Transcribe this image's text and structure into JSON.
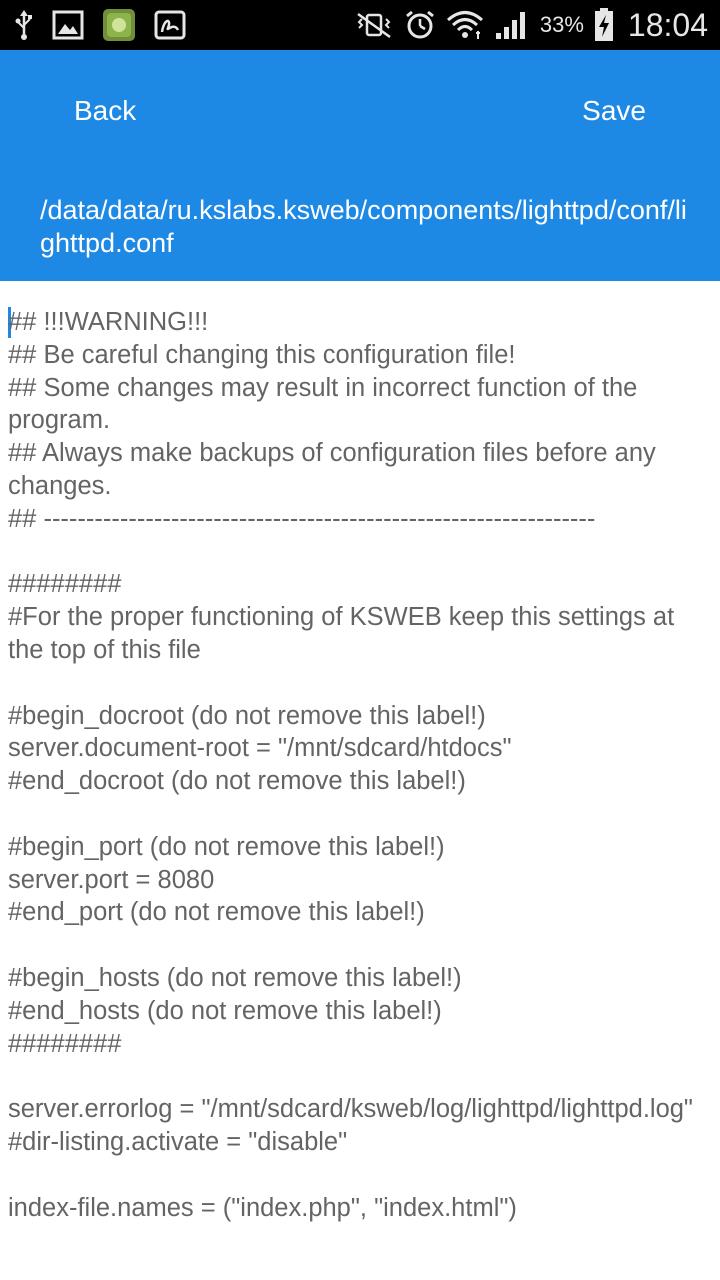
{
  "status_bar": {
    "icons_left": [
      "usb-icon",
      "image-notification-icon",
      "app-notification-icon",
      "signature-notification-icon"
    ],
    "icons_right": [
      "mute-vibrate-icon",
      "alarm-icon",
      "wifi-icon",
      "cellular-signal-icon",
      "battery-charging-icon"
    ],
    "battery_percent": "33%",
    "time": "18:04"
  },
  "app_bar": {
    "back_label": "Back",
    "save_label": "Save",
    "file_path": "/data/data/ru.kslabs.ksweb/components/lighttpd/conf/lighttpd.conf",
    "color": "#1e88e5"
  },
  "editor": {
    "content": "## !!!WARNING!!!\n## Be careful changing this configuration file!\n## Some changes may result in incorrect function of the program.\n## Always make backups of configuration files before any changes.\n## -----------------------------------------------------------------\n\n########\n#For the proper functioning of KSWEB keep this settings at the top of this file\n\n#begin_docroot (do not remove this label!)\nserver.document-root = \"/mnt/sdcard/htdocs\"\n#end_docroot (do not remove this label!)\n\n#begin_port (do not remove this label!)\nserver.port = 8080\n#end_port (do not remove this label!)\n\n#begin_hosts (do not remove this label!)\n#end_hosts (do not remove this label!)\n########\n\nserver.errorlog = \"/mnt/sdcard/ksweb/log/lighttpd/lighttpd.log\"\n#dir-listing.activate = \"disable\"\n\nindex-file.names = (\"index.php\", \"index.html\")",
    "text_color": "#646464"
  }
}
